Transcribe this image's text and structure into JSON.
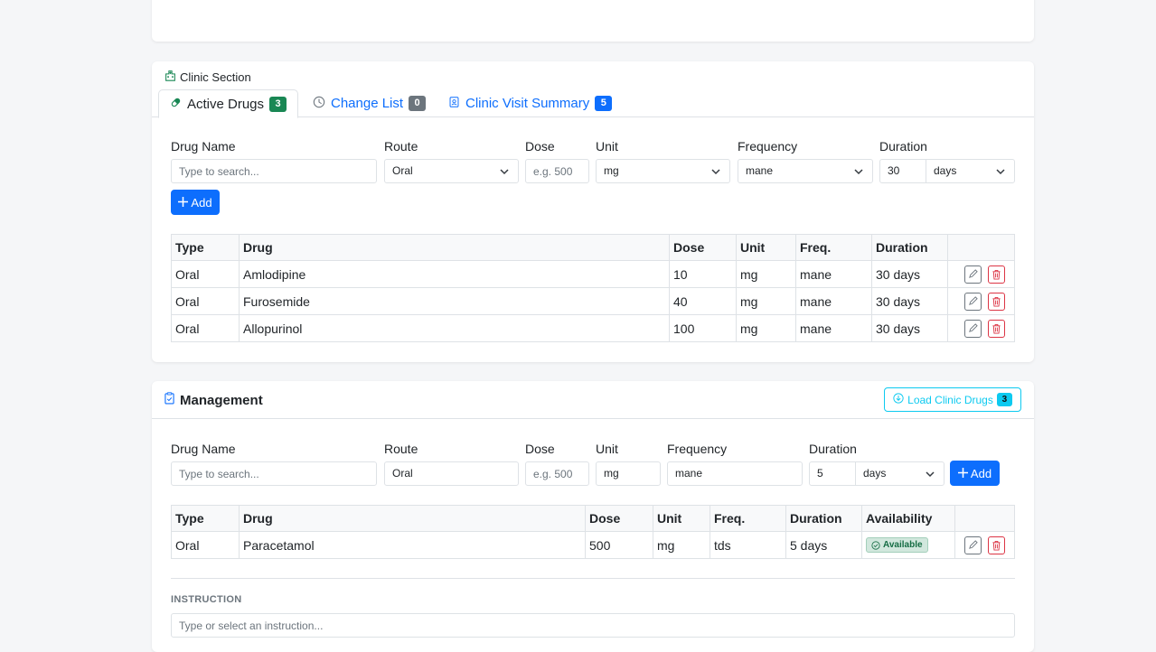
{
  "clinic": {
    "section_title": "Clinic Section",
    "tabs": [
      {
        "label": "Active Drugs",
        "badge": "3"
      },
      {
        "label": "Change List",
        "badge": "0"
      },
      {
        "label": "Clinic Visit Summary",
        "badge": "5"
      }
    ],
    "form": {
      "drug_name_label": "Drug Name",
      "drug_name_placeholder": "Type to search...",
      "route_label": "Route",
      "route_value": "Oral",
      "dose_label": "Dose",
      "dose_placeholder": "e.g. 500",
      "unit_label": "Unit",
      "unit_value": "mg",
      "frequency_label": "Frequency",
      "frequency_value": "mane",
      "duration_label": "Duration",
      "duration_value": "30",
      "duration_unit": "days",
      "add_label": "Add"
    },
    "table": {
      "headers": [
        "Type",
        "Drug",
        "Dose",
        "Unit",
        "Freq.",
        "Duration"
      ],
      "rows": [
        {
          "type": "Oral",
          "drug": "Amlodipine",
          "dose": "10",
          "unit": "mg",
          "freq": "mane",
          "duration": "30 days"
        },
        {
          "type": "Oral",
          "drug": "Furosemide",
          "dose": "40",
          "unit": "mg",
          "freq": "mane",
          "duration": "30 days"
        },
        {
          "type": "Oral",
          "drug": "Allopurinol",
          "dose": "100",
          "unit": "mg",
          "freq": "mane",
          "duration": "30 days"
        }
      ]
    }
  },
  "management": {
    "title": "Management",
    "load_button": "Load Clinic Drugs",
    "load_badge": "3",
    "form": {
      "drug_name_label": "Drug Name",
      "drug_name_placeholder": "Type to search...",
      "route_label": "Route",
      "route_value": "Oral",
      "dose_label": "Dose",
      "dose_placeholder": "e.g. 500",
      "unit_label": "Unit",
      "unit_value": "mg",
      "frequency_label": "Frequency",
      "frequency_value": "mane",
      "duration_label": "Duration",
      "duration_value": "5",
      "duration_unit": "days",
      "add_label": "Add"
    },
    "table": {
      "headers": [
        "Type",
        "Drug",
        "Dose",
        "Unit",
        "Freq.",
        "Duration",
        "Availability"
      ],
      "rows": [
        {
          "type": "Oral",
          "drug": "Paracetamol",
          "dose": "500",
          "unit": "mg",
          "freq": "tds",
          "duration": "5 days",
          "availability": "Available"
        }
      ]
    },
    "instruction_label": "INSTRUCTION",
    "instruction_placeholder": "Type or select an instruction..."
  },
  "colors": {
    "primary": "#0d6efd",
    "success": "#198754",
    "secondary": "#6c757d",
    "danger": "#dc3545",
    "info": "#0dcaf0"
  }
}
